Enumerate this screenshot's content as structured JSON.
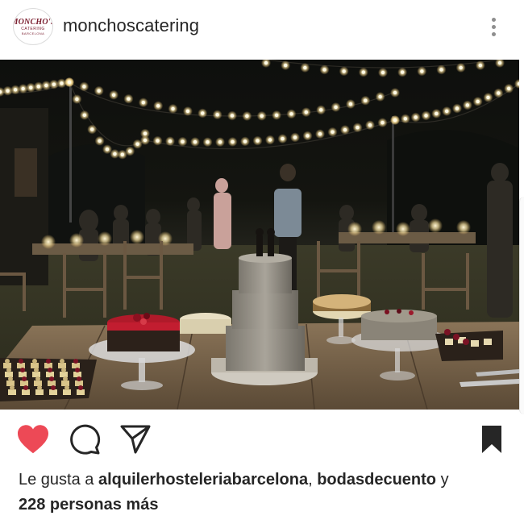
{
  "header": {
    "username": "monchoscatering",
    "avatar_logo": {
      "brand": "MONCHO'S",
      "sub": "CATERING",
      "sub2": "BARCELONA"
    }
  },
  "icons": {
    "more": "more-vertical-icon",
    "like": "heart-filled-icon",
    "comment": "comment-bubble-icon",
    "share": "paper-plane-icon",
    "save": "bookmark-filled-icon"
  },
  "colors": {
    "like_red": "#ed4956",
    "text": "#262626",
    "muted": "#8e8e8e"
  },
  "post": {
    "image_alt": "Outdoor evening wedding buffet with cakes under string lights"
  },
  "likes": {
    "prefix": "Le gusta a",
    "user1": "alquilerhosteleriabarcelona",
    "separator": ",",
    "user2": "bodasdecuento",
    "conjunction": "y",
    "others": "228 personas más"
  }
}
